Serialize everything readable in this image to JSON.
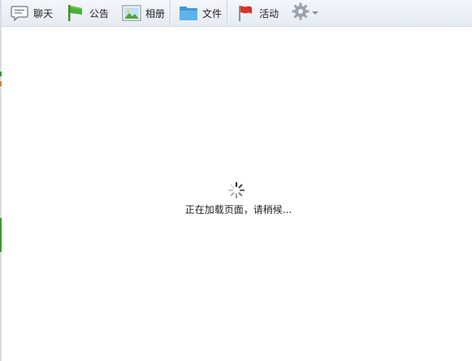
{
  "toolbar": {
    "items": [
      {
        "label": "聊天",
        "icon": "chat-bubble-icon"
      },
      {
        "label": "公告",
        "icon": "announcement-flag-icon"
      },
      {
        "label": "相册",
        "icon": "photo-album-icon"
      },
      {
        "label": "文件",
        "icon": "folder-icon"
      },
      {
        "label": "活动",
        "icon": "red-flag-icon"
      }
    ],
    "settings_icon": "gear-icon",
    "dropdown_icon": "caret-down-icon"
  },
  "content": {
    "loading_text": "正在加载页面，请稍候..."
  },
  "colors": {
    "toolbar_bg": "#e9eef4",
    "accent_green": "#3a9a2a",
    "folder_blue": "#4aa3e0",
    "flag_red": "#d9312b"
  }
}
